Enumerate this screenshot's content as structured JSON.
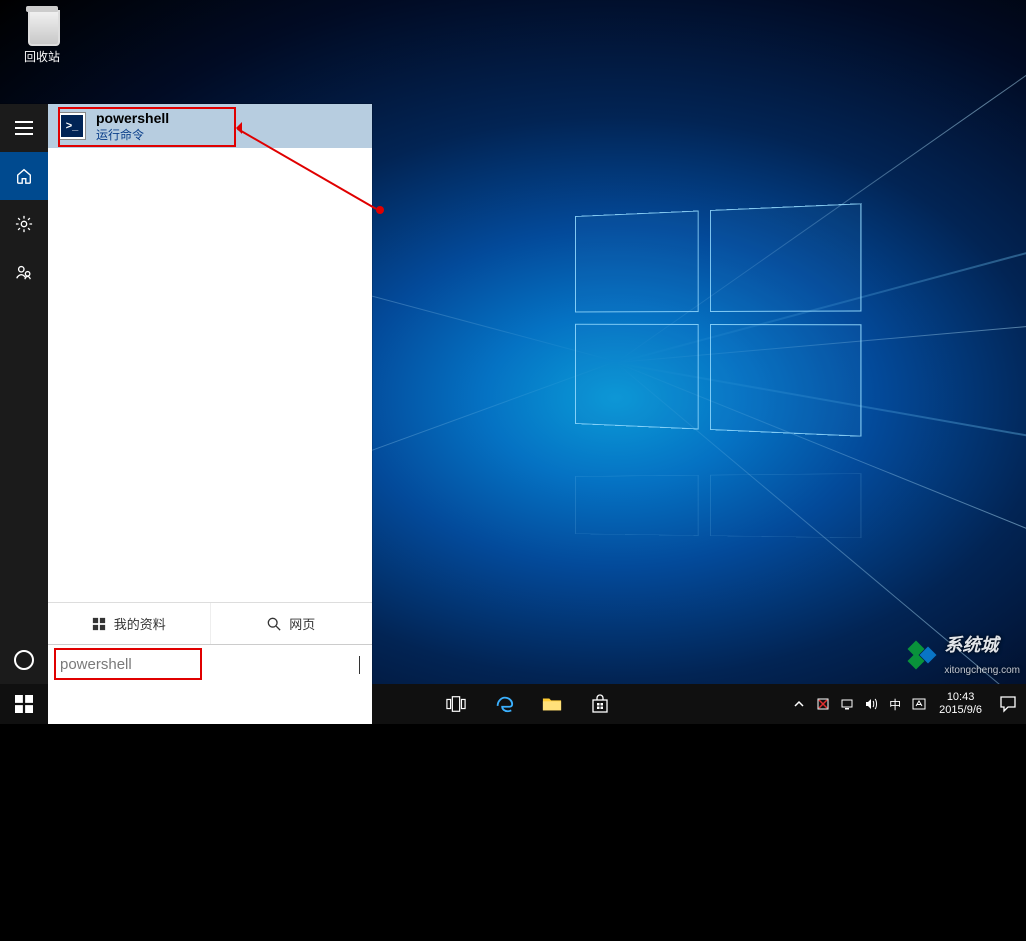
{
  "desktop": {
    "recycle_bin_label": "回收站"
  },
  "search": {
    "best_match": {
      "title": "powershell",
      "subtitle": "运行命令",
      "icon_glyph": ">_"
    },
    "filters": {
      "my_stuff": "我的资料",
      "web": "网页"
    },
    "input_value": "powershell"
  },
  "taskbar": {
    "tray": {
      "ime": "中",
      "time": "10:43",
      "date": "2015/9/6"
    }
  },
  "watermark": {
    "brand": "系统城",
    "sub": "xitongcheng.com"
  }
}
